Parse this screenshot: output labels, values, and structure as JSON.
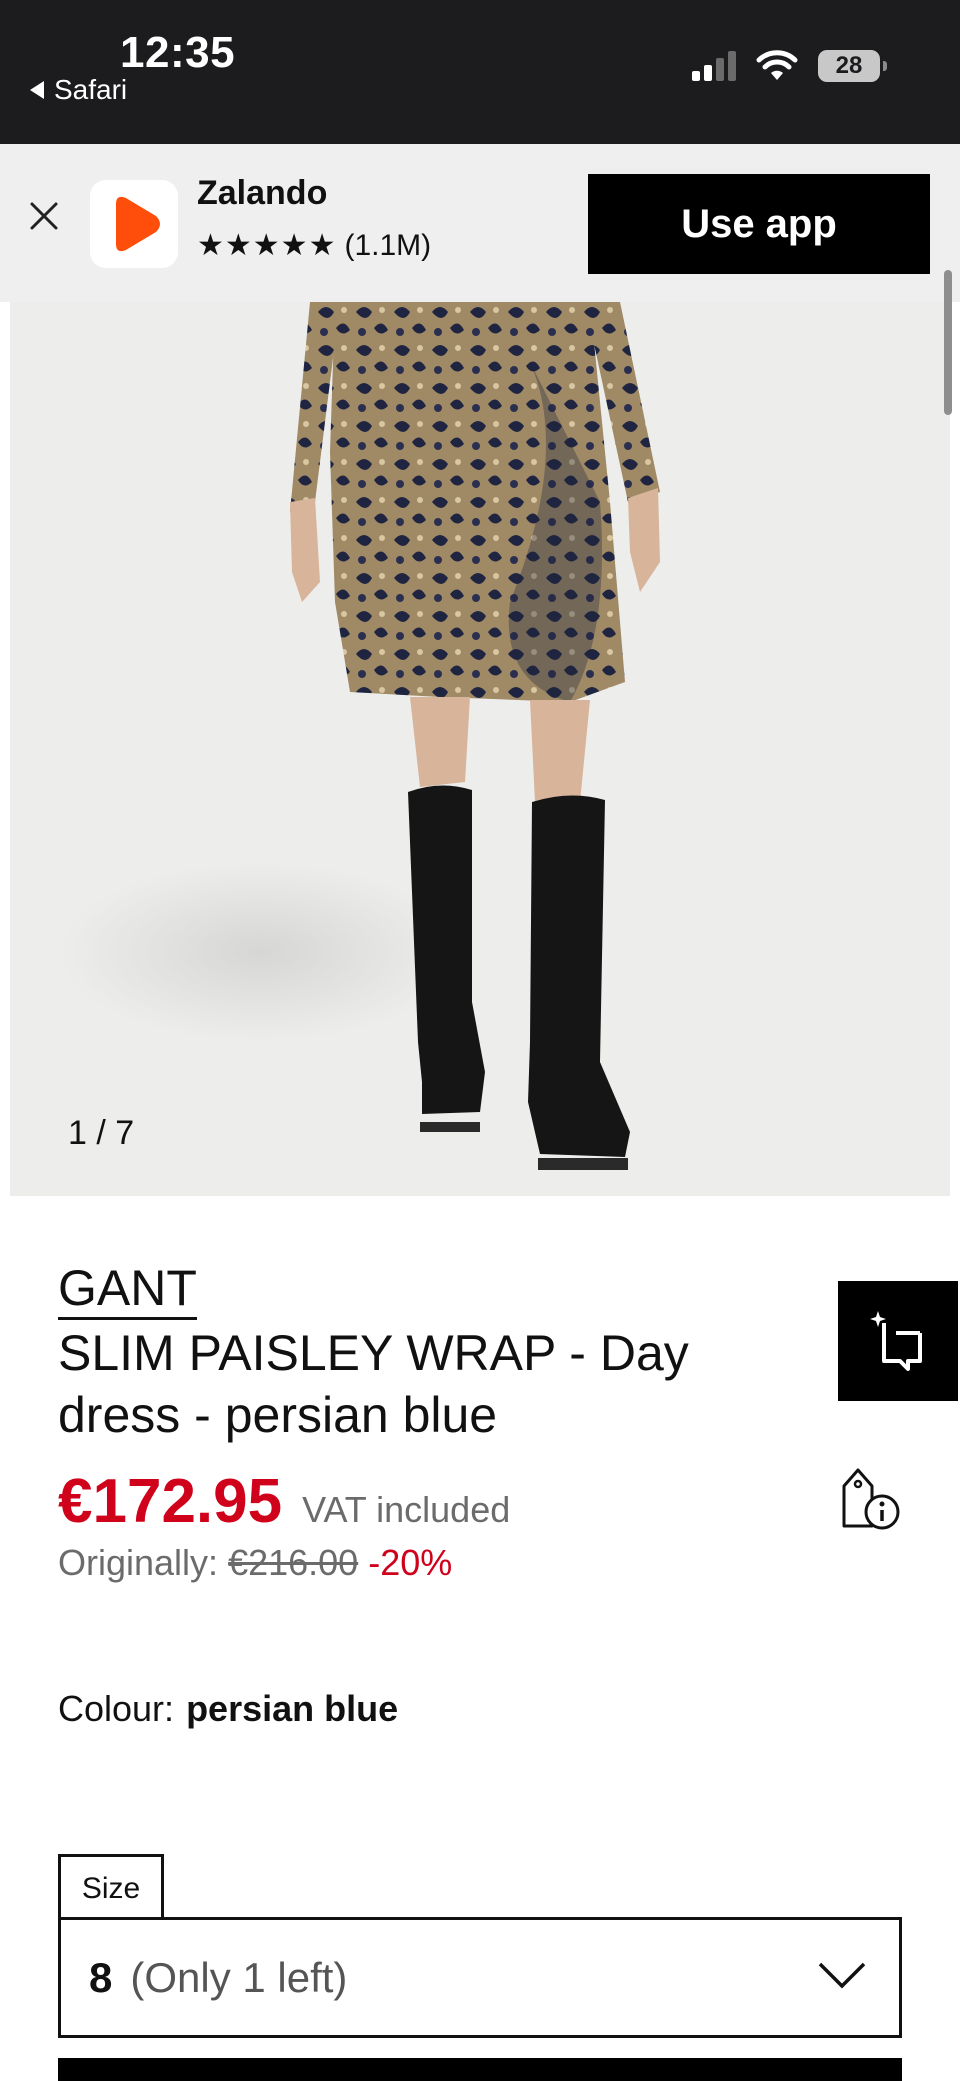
{
  "status_bar": {
    "time": "12:35",
    "back_app": "Safari",
    "battery": "28"
  },
  "app_banner": {
    "close_icon": "close-icon",
    "app_name": "Zalando",
    "stars": "★★★★★",
    "rating_count": "(1.1M)",
    "cta_label": "Use app",
    "logo_color": "#ff4e0b"
  },
  "gallery": {
    "counter": "1 / 7"
  },
  "product": {
    "brand": "GANT",
    "title": "SLIM PAISLEY WRAP - Day dress - persian blue",
    "price": "€172.95",
    "vat_note": "VAT included",
    "original_label": "Originally:",
    "original_price": "€216.00",
    "discount": "-20%",
    "colour_label": "Colour:",
    "colour_value": "persian blue"
  },
  "size_selector": {
    "label": "Size",
    "selected_size": "8",
    "stock_note": "(Only 1 left)"
  },
  "colors": {
    "sale_red": "#d0021b",
    "brand_orange": "#ff4e0b"
  }
}
